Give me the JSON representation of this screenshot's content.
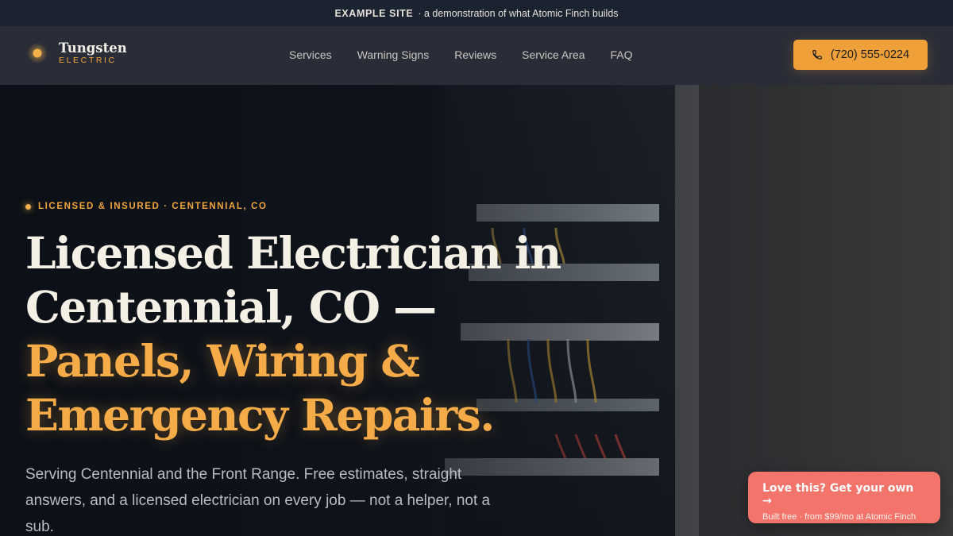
{
  "announcement": {
    "label": "EXAMPLE SITE",
    "text": "· a demonstration of what Atomic Finch builds"
  },
  "brand": {
    "name": "Tungsten",
    "sub": "ELECTRIC",
    "accent_color": "#f0a038"
  },
  "nav": {
    "items": [
      {
        "label": "Services"
      },
      {
        "label": "Warning Signs"
      },
      {
        "label": "Reviews"
      },
      {
        "label": "Service Area"
      },
      {
        "label": "FAQ"
      }
    ],
    "cta": {
      "label": "(720) 555-0224",
      "icon": "phone-icon"
    }
  },
  "hero": {
    "kicker": "LICENSED & INSURED · CENTENNIAL, CO",
    "headline_line1": "Licensed Electrician in",
    "headline_line2": "Centennial, CO —",
    "headline_accent1": "Panels, Wiring &",
    "headline_accent2": "Emergency Repairs.",
    "lede": "Serving Centennial and the Front Range. Free estimates, straight answers, and a licensed electrician on every job — not a helper, not a sub."
  },
  "promo": {
    "title": "Love this? Get your own →",
    "subtitle": "Built free · from $99/mo at Atomic Finch",
    "color": "#f2746a"
  }
}
